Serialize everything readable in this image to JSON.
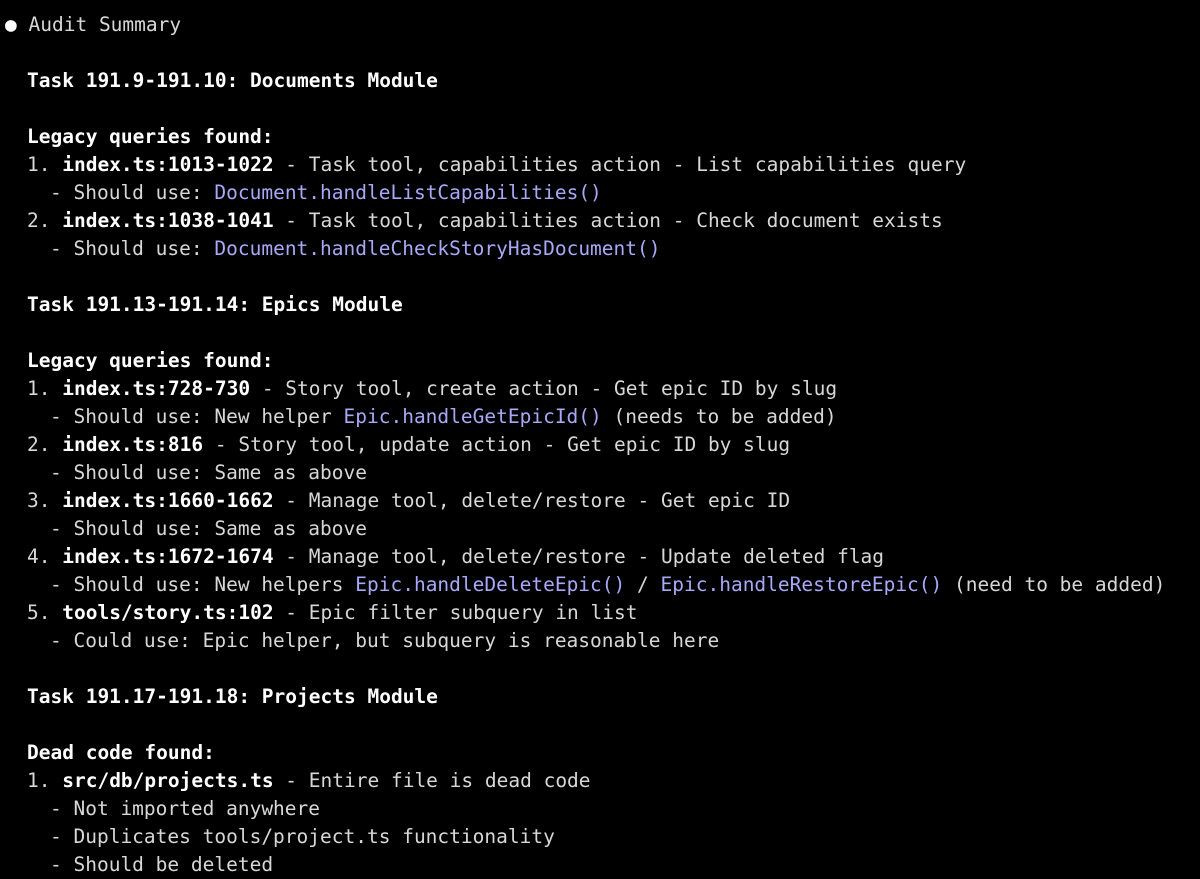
{
  "title": "Audit Summary",
  "bullet": "●",
  "sections": [
    {
      "heading": "Task 191.9-191.10: Documents Module",
      "subheading": "Legacy queries found:",
      "items": [
        {
          "num": "1.",
          "file": "index.ts:1013-1022",
          "desc": " - Task tool, capabilities action - List capabilities query",
          "sub": [
            {
              "prefix": "- Should use: ",
              "code": "Document.handleListCapabilities()",
              "suffix": ""
            }
          ]
        },
        {
          "num": "2.",
          "file": "index.ts:1038-1041",
          "desc": " - Task tool, capabilities action - Check document exists",
          "sub": [
            {
              "prefix": "- Should use: ",
              "code": "Document.handleCheckStoryHasDocument()",
              "suffix": ""
            }
          ]
        }
      ]
    },
    {
      "heading": "Task 191.13-191.14: Epics Module",
      "subheading": "Legacy queries found:",
      "items": [
        {
          "num": "1.",
          "file": "index.ts:728-730",
          "desc": " - Story tool, create action - Get epic ID by slug",
          "sub": [
            {
              "prefix": "- Should use: New helper ",
              "code": "Epic.handleGetEpicId()",
              "suffix": " (needs to be added)"
            }
          ]
        },
        {
          "num": "2.",
          "file": "index.ts:816",
          "desc": " - Story tool, update action - Get epic ID by slug",
          "sub": [
            {
              "prefix": "- Should use: Same as above",
              "code": "",
              "suffix": ""
            }
          ]
        },
        {
          "num": "3.",
          "file": "index.ts:1660-1662",
          "desc": " - Manage tool, delete/restore - Get epic ID",
          "sub": [
            {
              "prefix": "- Should use: Same as above",
              "code": "",
              "suffix": ""
            }
          ]
        },
        {
          "num": "4.",
          "file": "index.ts:1672-1674",
          "desc": " - Manage tool, delete/restore - Update deleted flag",
          "sub": [
            {
              "prefix": "- Should use: New helpers ",
              "code": "Epic.handleDeleteEpic()",
              "middle": " / ",
              "code2": "Epic.handleRestoreEpic()",
              "suffix": " (need to be added)"
            }
          ]
        },
        {
          "num": "5.",
          "file": "tools/story.ts:102",
          "desc": " - Epic filter subquery in list",
          "sub": [
            {
              "prefix": "- Could use: Epic helper, but subquery is reasonable here",
              "code": "",
              "suffix": ""
            }
          ]
        }
      ]
    },
    {
      "heading": "Task 191.17-191.18: Projects Module",
      "subheading": "Dead code found:",
      "items": [
        {
          "num": "1.",
          "file": "src/db/projects.ts",
          "desc": " - Entire file is dead code",
          "sub": [
            {
              "prefix": "- Not imported anywhere",
              "code": "",
              "suffix": ""
            },
            {
              "prefix": "- Duplicates tools/project.ts functionality",
              "code": "",
              "suffix": ""
            },
            {
              "prefix": "- Should be deleted",
              "code": "",
              "suffix": ""
            }
          ]
        }
      ]
    }
  ]
}
